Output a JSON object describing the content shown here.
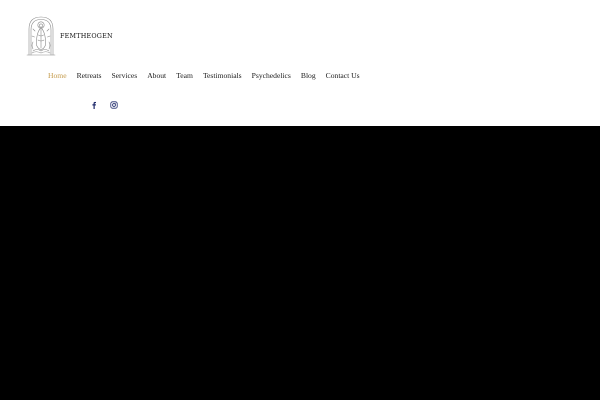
{
  "brand": {
    "name": "FEMTHEOGEN",
    "logo_icon": "goddess-line-art-icon"
  },
  "nav": {
    "items": [
      {
        "label": "Home",
        "active": true
      },
      {
        "label": "Retreats",
        "active": false
      },
      {
        "label": "Services",
        "active": false
      },
      {
        "label": "About",
        "active": false
      },
      {
        "label": "Team",
        "active": false
      },
      {
        "label": "Testimonials",
        "active": false
      },
      {
        "label": "Psychedelics",
        "active": false
      },
      {
        "label": "Blog",
        "active": false
      },
      {
        "label": "Contact Us",
        "active": false
      }
    ]
  },
  "social": {
    "icons": [
      "facebook-icon",
      "instagram-icon"
    ]
  },
  "colors": {
    "accent": "#c49a4a",
    "social_icon": "#1f2a6b",
    "hero_background": "#000000",
    "header_background": "#ffffff"
  }
}
